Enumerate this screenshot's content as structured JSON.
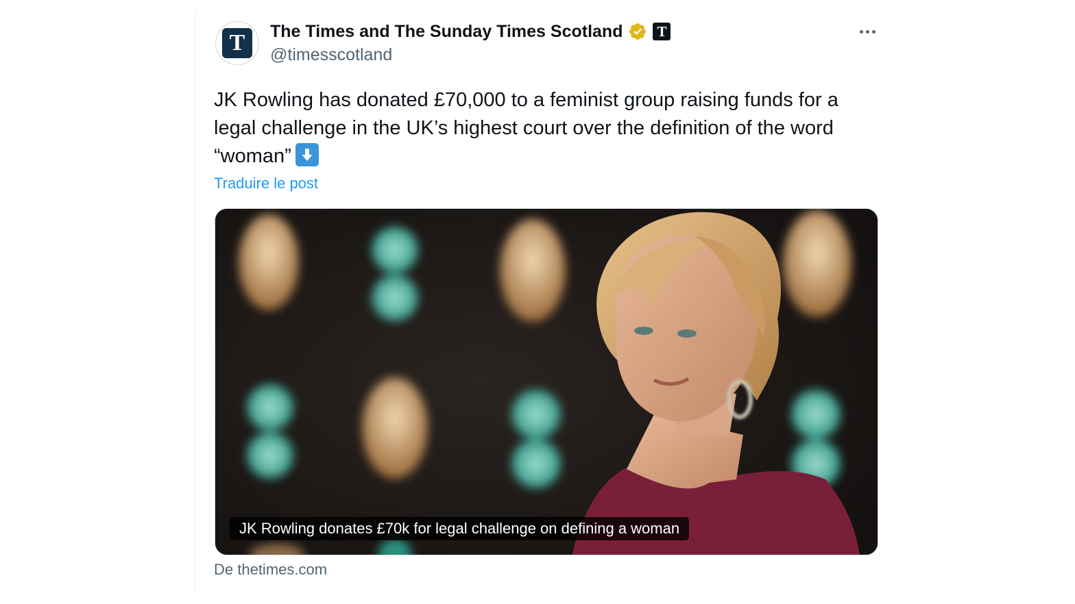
{
  "tweet": {
    "display_name": "The Times and The Sunday Times Scotland",
    "handle": "@timesscotland",
    "avatar_letter": "T",
    "affiliate_letter": "T",
    "verified_badge_color": "#e2b719",
    "text_line1": "JK Rowling has donated £70,000 to a feminist group raising funds for a",
    "text_line2": "legal challenge in the UK’s highest court over the definition of the word",
    "text_line3": "“woman”",
    "emoji": "down-arrow-emoji",
    "translate_label": "Traduire le post",
    "link_card": {
      "caption": "JK Rowling donates £70k for legal challenge on defining a woman",
      "source": "De thetimes.com",
      "image": "photo-of-jk-rowling-at-bafta-event"
    }
  },
  "colors": {
    "text_primary": "#0f1419",
    "text_secondary": "#536471",
    "link_blue": "#1d9bf0",
    "avatar_navy": "#12314a"
  }
}
